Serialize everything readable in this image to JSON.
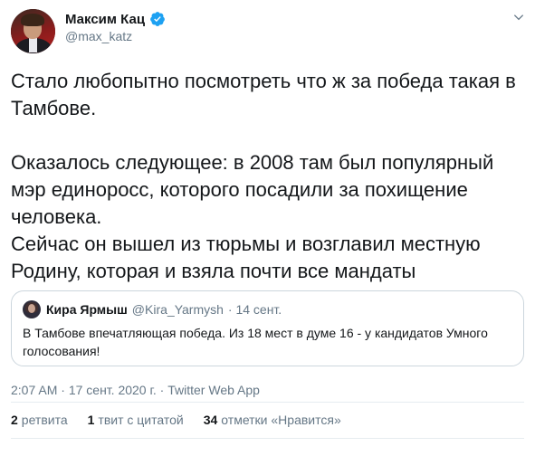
{
  "author": {
    "name": "Максим Кац",
    "handle": "@max_katz",
    "verified": true
  },
  "icons": {
    "verified": "verified-badge-icon",
    "menu": "chevron-down-icon"
  },
  "colors": {
    "verified": "#1da1f2",
    "muted": "#657786",
    "text": "#14171a",
    "border": "#ccd6dd"
  },
  "tweet": {
    "paragraph1": "Стало любопытно посмотреть что ж за победа такая в Тамбове.",
    "paragraph2": "Оказалось следующее: в 2008 там был популярный мэр единоросс, которого посадили за похищение человека.",
    "paragraph3": "Сейчас он вышел из тюрьмы и возглавил местную Родину, которая и взяла почти все мандаты"
  },
  "quote": {
    "name": "Кира Ярмыш",
    "handle": "@Kira_Yarmysh",
    "date": "· 14 сент.",
    "text": "В Тамбове впечатляющая победа. Из 18 мест в думе 16 - у кандидатов Умного голосования!"
  },
  "meta": {
    "time": "2:07 AM",
    "sep1": " · ",
    "date": "17 сент. 2020 г.",
    "sep2": " · ",
    "source": "Twitter Web App"
  },
  "stats": {
    "retweets_count": "2",
    "retweets_label": "ретвита",
    "quotes_count": "1",
    "quotes_label": "твит с цитатой",
    "likes_count": "34",
    "likes_label": "отметки «Нравится»"
  }
}
